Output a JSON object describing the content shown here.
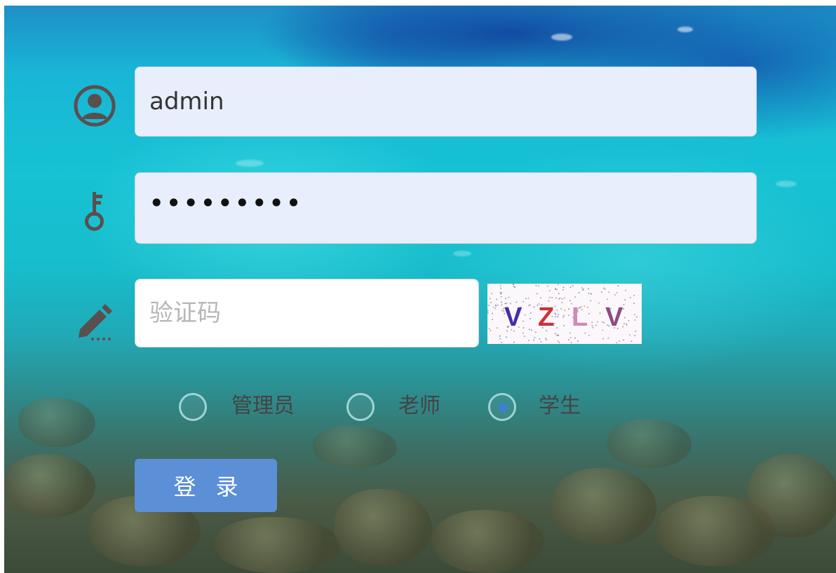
{
  "login_form": {
    "username": {
      "icon": "user-avatar-icon",
      "value": "admin"
    },
    "password": {
      "icon": "key-icon",
      "masked_value": "•••••••••"
    },
    "captcha": {
      "icon": "pencil-icon",
      "placeholder": "验证码",
      "image_text": [
        "V",
        "Z",
        "L",
        "V"
      ],
      "image_colors": [
        "#4b2aa6",
        "#d0303a",
        "#d08ab8",
        "#8c4a86"
      ]
    },
    "roles": {
      "options": [
        "管理员",
        "老师",
        "学生"
      ],
      "selected": "学生"
    },
    "submit_label": "登录"
  },
  "colors": {
    "accent": "#5b8fd6",
    "radio_dot": "#3f7fda",
    "field_filled_bg": "#e8eefc"
  }
}
